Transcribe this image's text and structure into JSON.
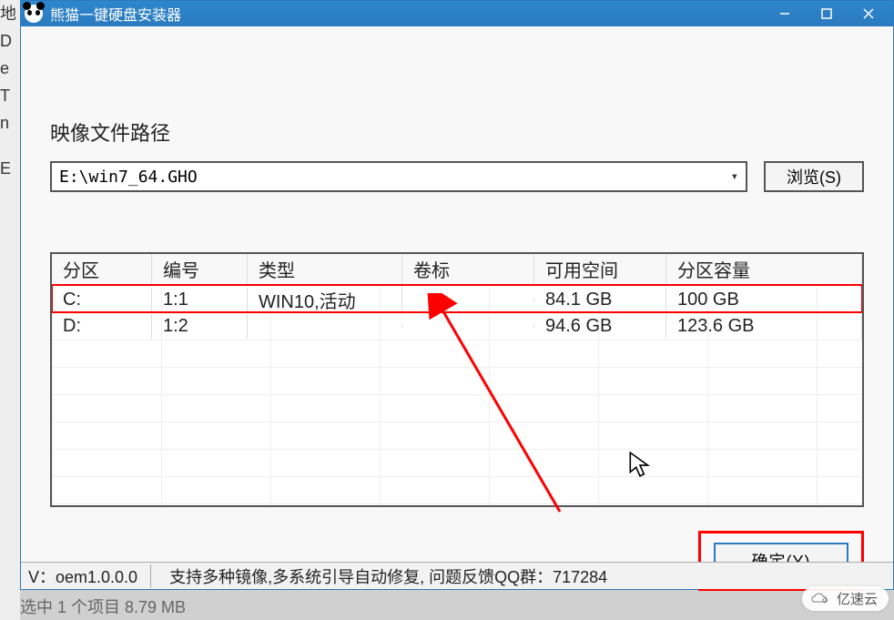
{
  "titlebar": {
    "app_title": "熊猫一键硬盘安装器"
  },
  "section": {
    "path_label": "映像文件路径",
    "path_value": "E:\\win7_64.GHO",
    "browse_label": "浏览(S)"
  },
  "table": {
    "headers": {
      "partition": "分区",
      "number": "编号",
      "type": "类型",
      "label": "卷标",
      "free": "可用空间",
      "capacity": "分区容量"
    },
    "rows": [
      {
        "partition": "C:",
        "number": "1:1",
        "type": "WIN10,活动",
        "label": "",
        "free": "84.1 GB",
        "capacity": "100 GB"
      },
      {
        "partition": "D:",
        "number": "1:2",
        "type": "",
        "label": "",
        "free": "94.6 GB",
        "capacity": "123.6 GB"
      }
    ]
  },
  "buttons": {
    "ok_label": "确定(Y)"
  },
  "statusbar": {
    "version": "V：oem1.0.0.0",
    "note": "支持多种镜像,多系统引导自动修复, 问题反馈QQ群：717284"
  },
  "behind_text": "选中 1 个项目  8.79 MB",
  "side_letters": [
    "地",
    "D",
    "e",
    "T",
    "n",
    "E"
  ],
  "watermark": "亿速云"
}
